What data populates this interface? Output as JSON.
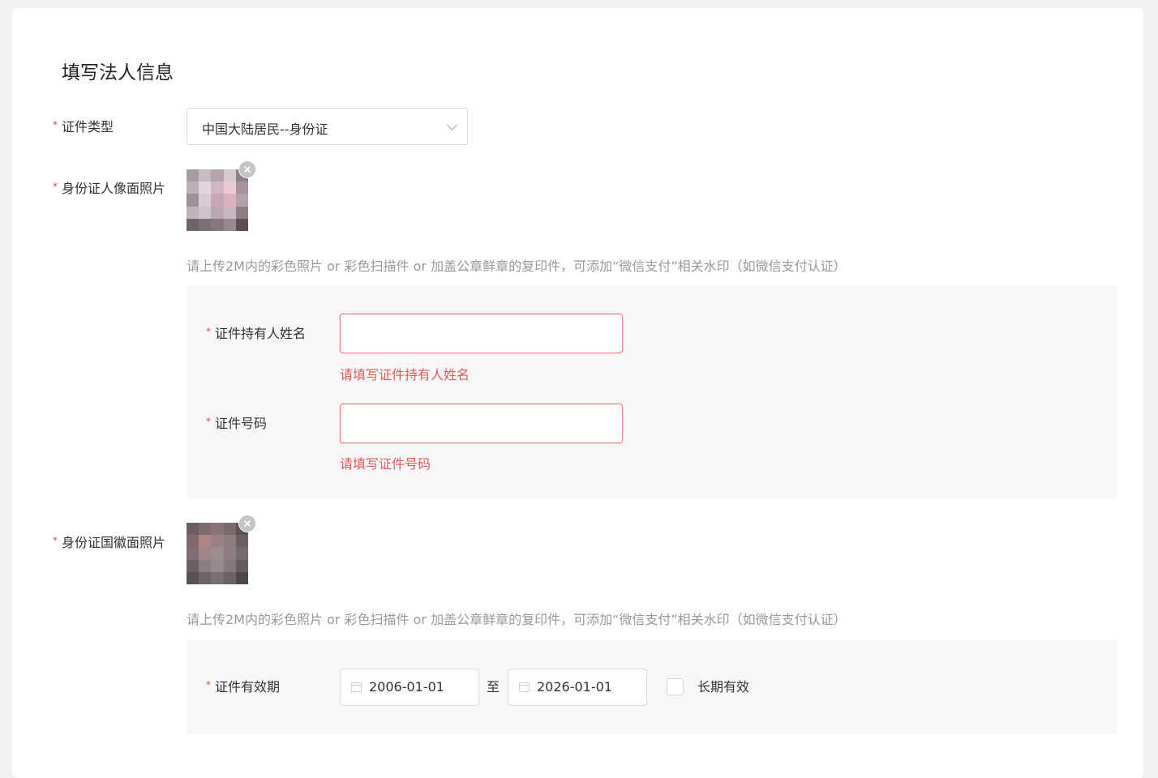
{
  "form": {
    "title": "填写法人信息",
    "required_mark": "*",
    "id_type": {
      "label": "证件类型",
      "value": "中国大陆居民--身份证"
    },
    "front_photo": {
      "label": "身份证人像面照片",
      "hint": "请上传2M内的彩色照片 or 彩色扫描件 or 加盖公章鲜章的复印件，可添加“微信支付”相关水印（如微信支付认证）"
    },
    "holder_name": {
      "label": "证件持有人姓名",
      "value": "",
      "error": "请填写证件持有人姓名"
    },
    "id_number": {
      "label": "证件号码",
      "value": "",
      "error": "请填写证件号码"
    },
    "back_photo": {
      "label": "身份证国徽面照片",
      "hint": "请上传2M内的彩色照片 or 彩色扫描件 or 加盖公章鲜章的复印件，可添加“微信支付”相关水印（如微信支付认证）"
    },
    "validity": {
      "label": "证件有效期",
      "start": "2006-01-01",
      "separator": "至",
      "end": "2026-01-01",
      "long_term_label": "长期有效",
      "long_term_checked": false
    }
  },
  "colors": {
    "required": "#e04a4a",
    "error_text": "#e25b5b",
    "error_border": "#f08585",
    "hint_text": "#999999",
    "panel_bg": "#f7f7f7"
  }
}
